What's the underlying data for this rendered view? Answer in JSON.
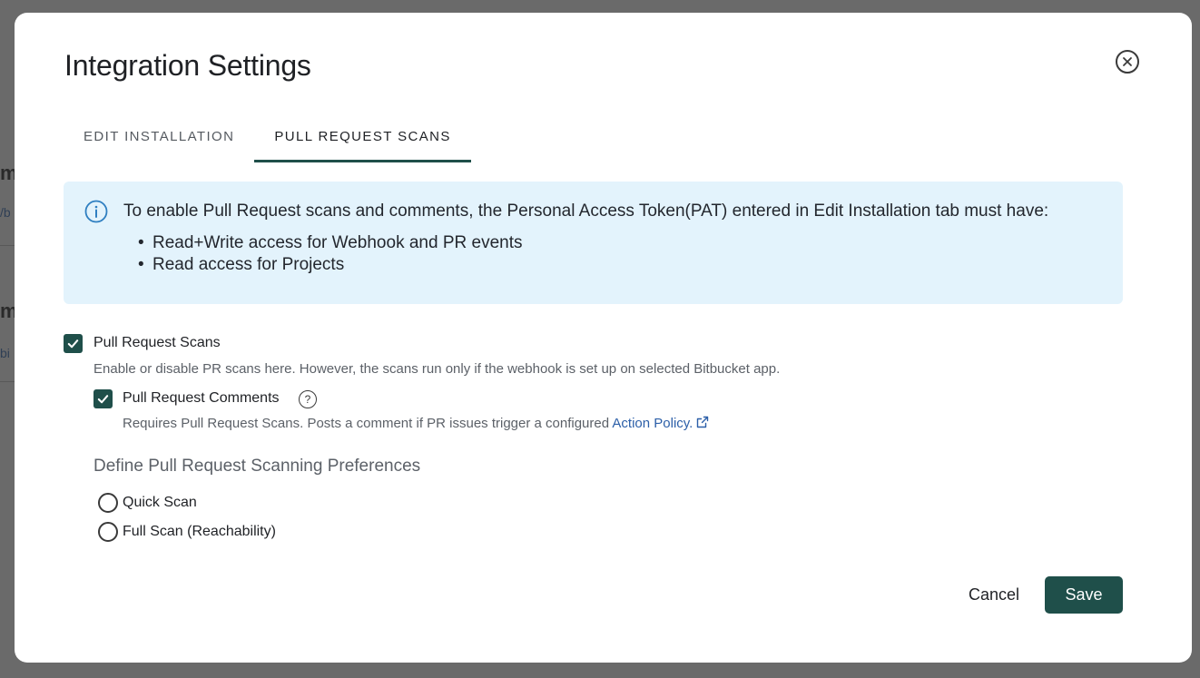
{
  "background": {
    "fragment_1": "m",
    "fragment_2": "/b",
    "fragment_3": "m",
    "fragment_4": "bi"
  },
  "modal": {
    "title": "Integration Settings",
    "close_icon": "close-circle-icon"
  },
  "tabs": [
    {
      "label": "EDIT INSTALLATION",
      "active": false
    },
    {
      "label": "PULL REQUEST SCANS",
      "active": true
    }
  ],
  "info": {
    "icon": "info-icon",
    "text": "To enable Pull Request scans and comments, the Personal Access Token(PAT) entered in Edit Installation tab must have:",
    "bullets": [
      "Read+Write access for Webhook and PR events",
      "Read access for Projects"
    ]
  },
  "pr_scans": {
    "checked": true,
    "label": "Pull Request Scans",
    "description": "Enable or disable PR scans here. However, the scans run only if the webhook is set up on selected Bitbucket app."
  },
  "pr_comments": {
    "checked": true,
    "label": "Pull Request Comments",
    "help_icon": "?",
    "description": "Requires Pull Request Scans. Posts a comment if PR issues trigger a configured ",
    "link_text": "Action Policy."
  },
  "preferences": {
    "title": "Define Pull Request Scanning Preferences",
    "options": [
      {
        "label": "Quick Scan",
        "selected": false
      },
      {
        "label": "Full Scan (Reachability)",
        "selected": false
      }
    ]
  },
  "footer": {
    "cancel_label": "Cancel",
    "save_label": "Save"
  },
  "colors": {
    "accent": "#1f4f4a",
    "info_bg": "#e3f3fc",
    "link": "#2c5fa8"
  }
}
